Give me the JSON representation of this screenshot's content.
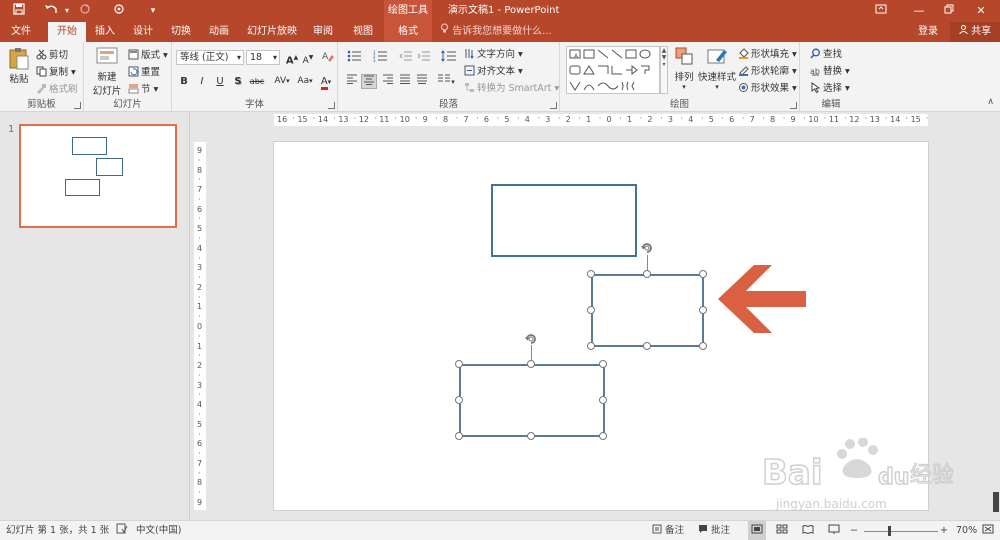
{
  "titlebar": {
    "context_group": "绘图工具",
    "title": "演示文稿1 - PowerPoint",
    "icons": [
      "save-icon",
      "undo-icon",
      "redo-icon",
      "touch-mode-icon",
      "customize-icon"
    ]
  },
  "tabs": [
    {
      "label": "文件",
      "state": "normal"
    },
    {
      "label": "开始",
      "state": "active"
    },
    {
      "label": "插入",
      "state": "normal"
    },
    {
      "label": "设计",
      "state": "normal"
    },
    {
      "label": "切换",
      "state": "normal"
    },
    {
      "label": "动画",
      "state": "normal"
    },
    {
      "label": "幻灯片放映",
      "state": "normal"
    },
    {
      "label": "审阅",
      "state": "normal"
    },
    {
      "label": "视图",
      "state": "normal"
    },
    {
      "label": "格式",
      "state": "context"
    }
  ],
  "tellme": "告诉我您想要做什么...",
  "account": {
    "login": "登录",
    "share": "共享"
  },
  "ribbon": {
    "clipboard": {
      "label": "剪贴板",
      "paste": "粘贴",
      "cut": "剪切",
      "copy": "复制",
      "format_painter": "格式刷"
    },
    "slides": {
      "label": "幻灯片",
      "new_slide": "新建",
      "new_slide2": "幻灯片",
      "layout": "版式",
      "reset": "重置",
      "section": "节"
    },
    "font": {
      "label": "字体",
      "font_name": "等线 (正文)",
      "font_size": "18",
      "bold": "B",
      "italic": "I",
      "underline": "U",
      "shadow": "S",
      "strike": "abc",
      "spacing": "AV",
      "case": "Aa",
      "color": "A",
      "grow": "A",
      "shrink": "A"
    },
    "paragraph": {
      "label": "段落",
      "text_direction": "文字方向",
      "align_text": "对齐文本",
      "smartart": "转换为 SmartArt"
    },
    "drawing": {
      "label": "绘图",
      "arrange": "排列",
      "quick_styles": "快速样式",
      "shape_fill": "形状填充",
      "shape_outline": "形状轮廓",
      "shape_effects": "形状效果"
    },
    "editing": {
      "label": "编辑",
      "find": "查找",
      "replace": "替换",
      "select": "选择"
    }
  },
  "thumbnail": {
    "slide_number": "1"
  },
  "ruler": {
    "h_labels": [
      "16",
      "15",
      "14",
      "13",
      "12",
      "11",
      "10",
      "9",
      "8",
      "7",
      "6",
      "5",
      "4",
      "3",
      "2",
      "1",
      "0",
      "1",
      "2",
      "3",
      "4",
      "5",
      "6",
      "7",
      "8",
      "9",
      "10",
      "11",
      "12",
      "13",
      "14",
      "15",
      "16"
    ],
    "v_labels": [
      "9",
      "8",
      "7",
      "6",
      "5",
      "4",
      "3",
      "2",
      "1",
      "0",
      "1",
      "2",
      "3",
      "4",
      "5",
      "6",
      "7",
      "8",
      "9"
    ]
  },
  "colors": {
    "accent": "#b7472a",
    "shape_outline": "#41719c",
    "arrow": "#d96040",
    "thumb_border": "#e46c4a"
  },
  "statusbar": {
    "slide_info": "幻灯片 第 1 张，共 1 张",
    "language": "中文(中国)",
    "notes": "备注",
    "comments": "批注",
    "zoom": "70%"
  },
  "watermark": {
    "brand": "Bai du 经验",
    "url": "jingyan.baidu.com"
  }
}
